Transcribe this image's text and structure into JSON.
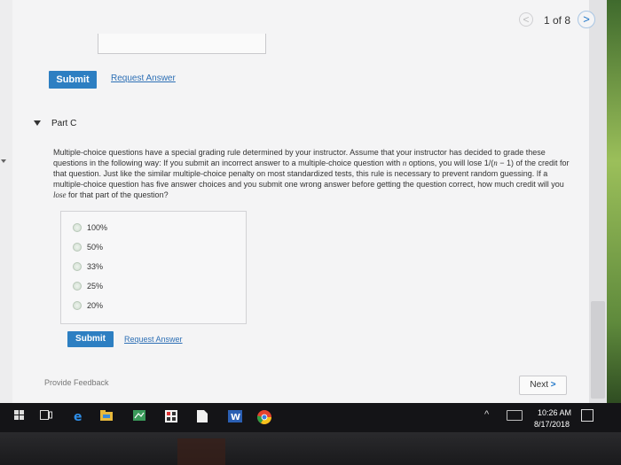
{
  "pager": {
    "prev": "<",
    "count": "1 of 8",
    "next": ">"
  },
  "part_b": {
    "submit_label": "Submit",
    "request_label": "Request Answer"
  },
  "part_c": {
    "title": "Part C",
    "question": {
      "pre": "Multiple-choice questions have a special grading rule determined by your instructor. Assume that your instructor has decided to grade these questions in the following way: If you submit an incorrect answer to a multiple-choice question with ",
      "n1": "n",
      "mid1": " options, you will lose 1/(",
      "n2": "n",
      "mid2": " − 1) of the credit for that question. Just like the similar multiple-choice penalty on most standardized tests, this rule is necessary to prevent random guessing. If a multiple-choice question has five answer choices and you submit one wrong answer before getting the question correct, how much credit will you ",
      "lose": "lose",
      "post": " for that part of the question?"
    },
    "options": [
      "100%",
      "50%",
      "33%",
      "25%",
      "20%"
    ],
    "submit_label": "Submit",
    "request_label": "Request Answer"
  },
  "footer": {
    "feedback": "Provide Feedback",
    "next_label": "Next",
    "next_arrow": ">"
  },
  "taskbar": {
    "icons": [
      "start-icon",
      "task-view-icon",
      "edge-icon",
      "file-explorer-icon",
      "store-icon",
      "calculator-icon",
      "files-icon",
      "word-icon",
      "chrome-icon"
    ],
    "time": "10:26 AM",
    "date": "8/17/2018"
  },
  "colors": {
    "accent": "#2d7fc2",
    "link": "#2d6fb5"
  }
}
